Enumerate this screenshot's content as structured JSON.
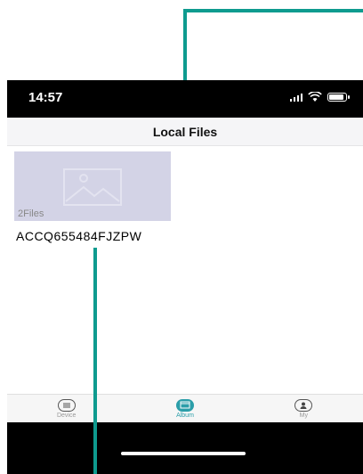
{
  "status": {
    "time": "14:57"
  },
  "nav": {
    "title": "Local Files"
  },
  "album": {
    "count": "2Files",
    "name": "ACCQ655484FJZPW"
  },
  "tabs": [
    {
      "label": "Device",
      "icon": "device-icon",
      "active": false
    },
    {
      "label": "Album",
      "icon": "album-icon",
      "active": true
    },
    {
      "label": "My",
      "icon": "user-icon",
      "active": false
    }
  ],
  "colors": {
    "accent": "#2b9ea9",
    "annotation": "#0e9b8f",
    "thumbnail": "#d3d3e6"
  }
}
